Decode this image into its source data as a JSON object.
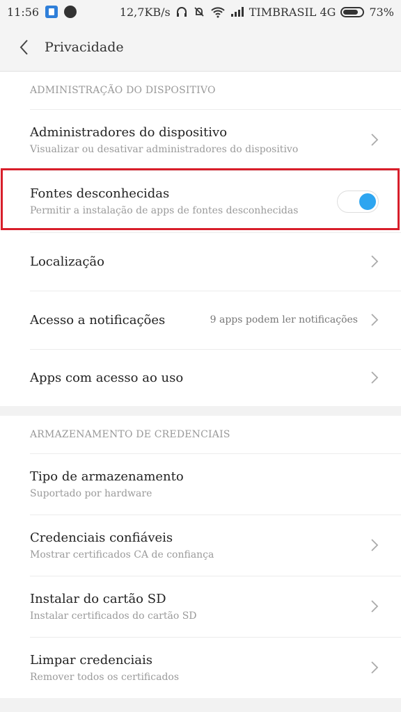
{
  "status_bar": {
    "time": "11:56",
    "speed": "12,7KB/s",
    "carrier": "TIMBRASIL 4G",
    "battery": "73%",
    "icons": [
      "app-icon",
      "app-icon",
      "headphones-icon",
      "mute-icon",
      "wifi-icon",
      "signal-icon",
      "battery-icon"
    ]
  },
  "header": {
    "title": "Privacidade"
  },
  "section_admin": {
    "title": "ADMINISTRAÇÃO DO DISPOSITIVO",
    "items": [
      {
        "title": "Administradores do dispositivo",
        "subtitle": "Visualizar ou desativar administradores do dispositivo"
      },
      {
        "title": "Fontes desconhecidas",
        "subtitle": "Permitir a instalação de apps de fontes desconhecidas",
        "toggle": true
      },
      {
        "title": "Localização"
      },
      {
        "title": "Acesso a notificações",
        "value": "9 apps podem ler notificações"
      },
      {
        "title": "Apps com acesso ao uso"
      }
    ]
  },
  "section_cred": {
    "title": "ARMAZENAMENTO DE CREDENCIAIS",
    "items": [
      {
        "title": "Tipo de armazenamento",
        "subtitle": "Suportado por hardware"
      },
      {
        "title": "Credenciais confiáveis",
        "subtitle": "Mostrar certificados CA de confiança"
      },
      {
        "title": "Instalar do cartão SD",
        "subtitle": "Instalar certificados do cartão SD"
      },
      {
        "title": "Limpar credenciais",
        "subtitle": "Remover todos os certificados"
      }
    ]
  },
  "colors": {
    "toggle_on": "#2da5f0",
    "highlight": "#d81e2a"
  }
}
